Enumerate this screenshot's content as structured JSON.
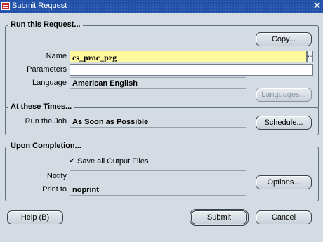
{
  "window": {
    "title": "Submit Request"
  },
  "run_request": {
    "title": "Run this Request...",
    "copy_button": "Copy...",
    "name_label": "Name",
    "name_value": "cs_proc_prg",
    "lov_glyph": "...",
    "parameters_label": "Parameters",
    "parameters_value": "",
    "language_label": "Language",
    "language_value": "American English",
    "languages_button": "Languages..."
  },
  "times": {
    "title": "At these Times...",
    "run_job_label": "Run the Job",
    "run_job_value": "As Soon as Possible",
    "schedule_button": "Schedule..."
  },
  "completion": {
    "title": "Upon Completion...",
    "save_output_label": "Save all Output Files",
    "save_output_checked": true,
    "notify_label": "Notify",
    "notify_value": "",
    "print_to_label": "Print to",
    "print_to_value": "noprint",
    "options_button": "Options..."
  },
  "footer": {
    "help_button": "Help (B)",
    "submit_button": "Submit",
    "cancel_button": "Cancel"
  },
  "icons": {
    "close": "close-icon",
    "app": "oracle-forms-icon",
    "check": "checkmark-icon"
  }
}
